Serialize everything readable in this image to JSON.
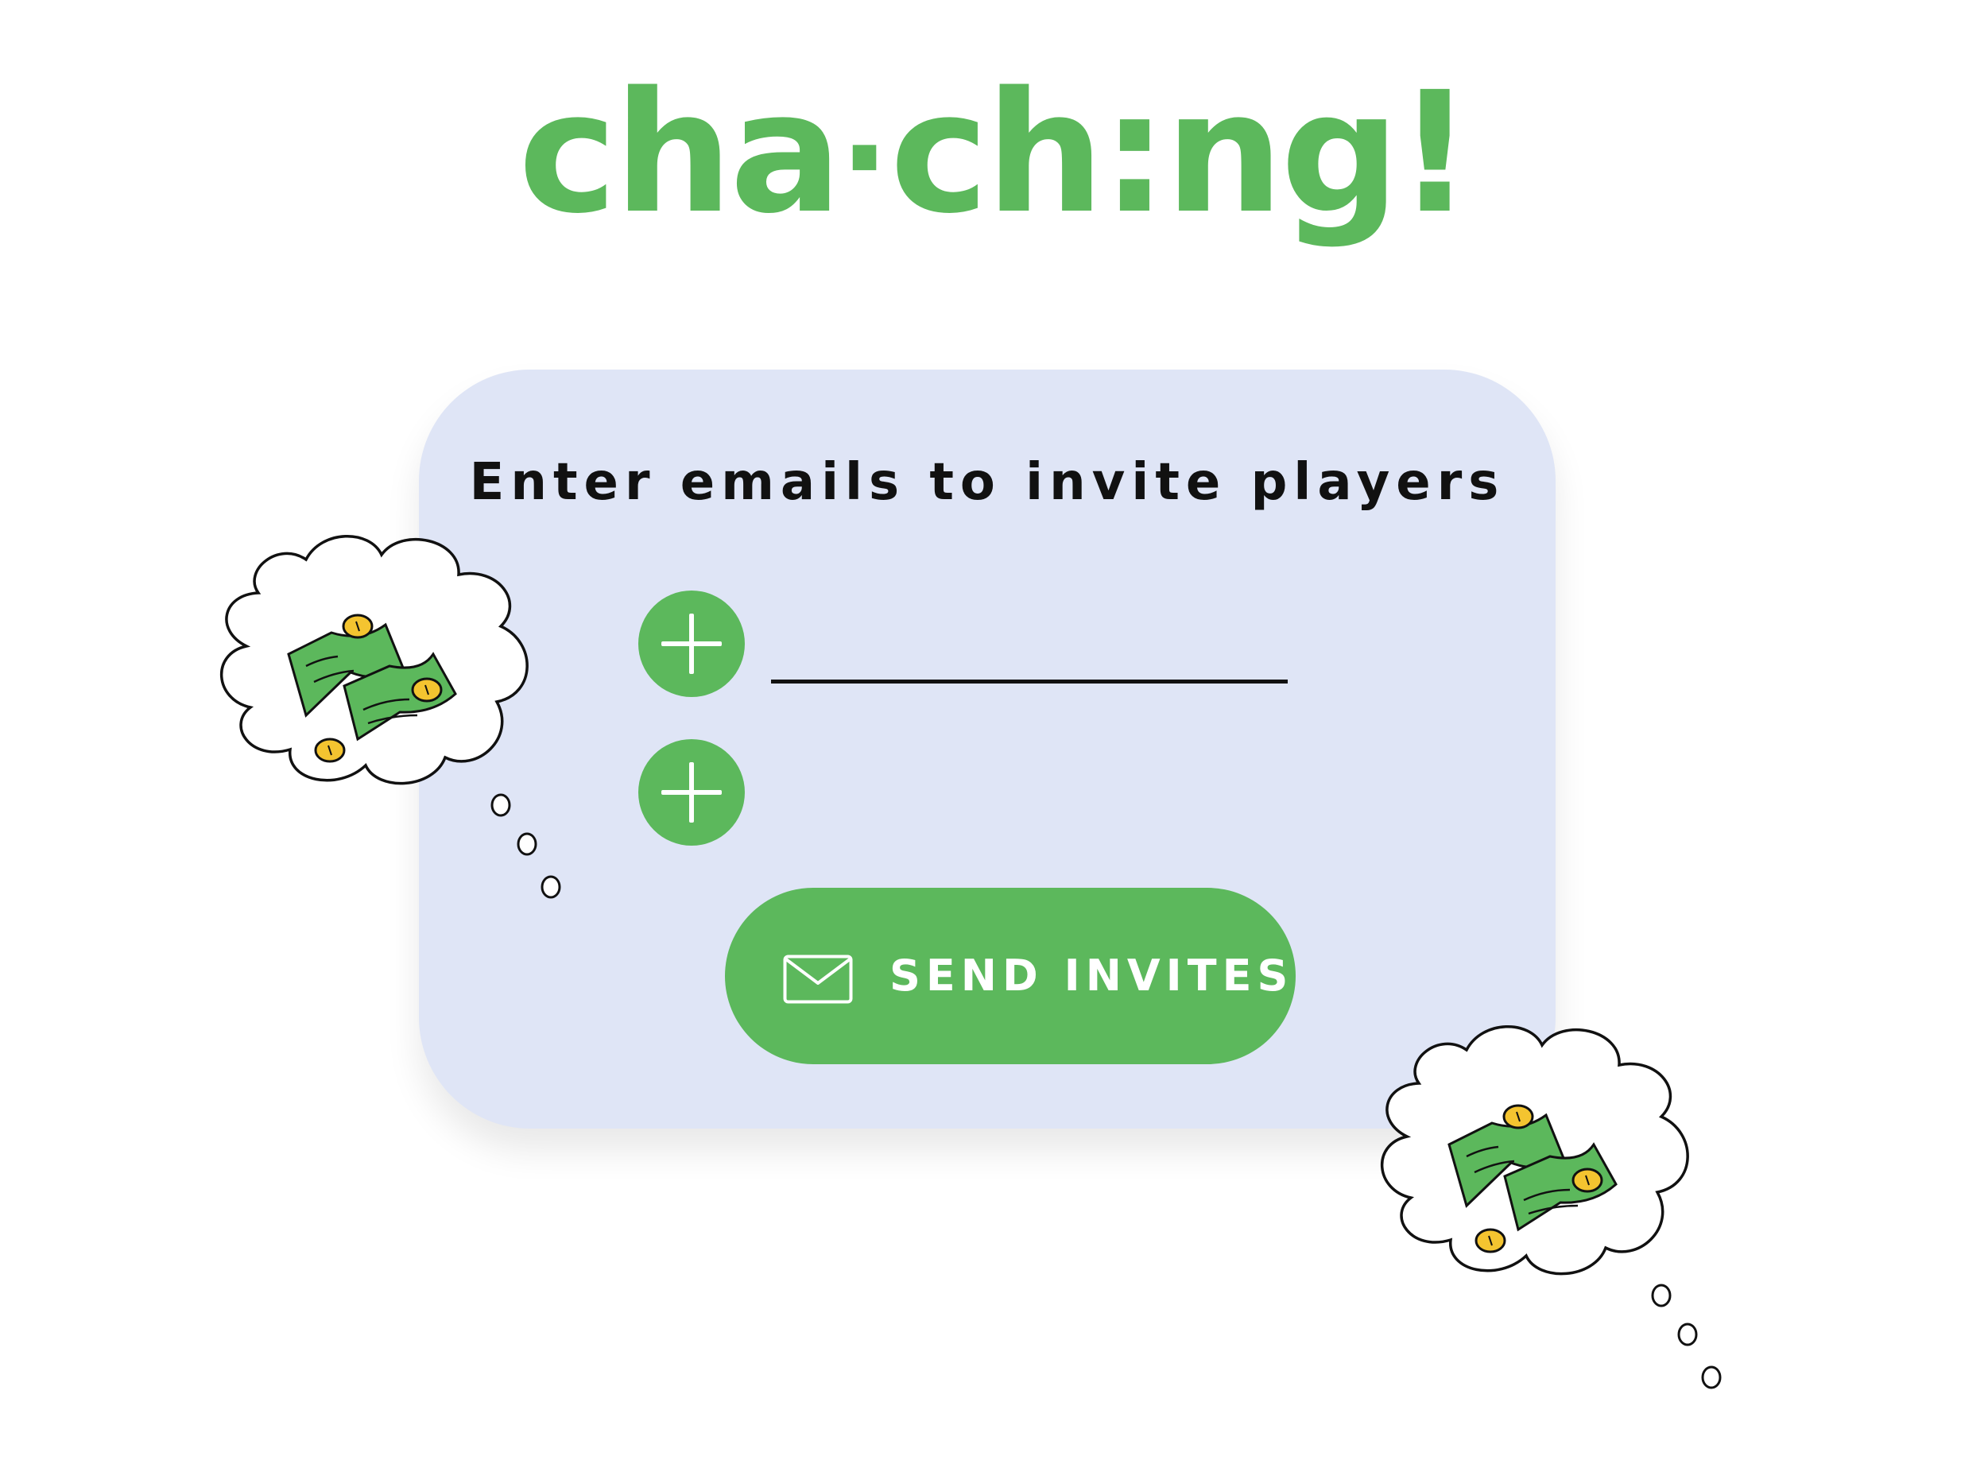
{
  "logo": {
    "part1": "cha",
    "dot": "·",
    "part2": "ch",
    "colon": ":",
    "part3": "ng!"
  },
  "invite": {
    "heading": "Enter emails to invite players",
    "email_value": "",
    "send_label": "SEND INVITES"
  },
  "colors": {
    "brand_green": "#5cb85c",
    "card_bg": "#dfe5f6",
    "coin_yellow": "#f4c430",
    "text": "#111111"
  },
  "icons": [
    "plus-icon",
    "plus-icon",
    "envelope-icon",
    "money-thought-cloud",
    "money-thought-cloud"
  ]
}
